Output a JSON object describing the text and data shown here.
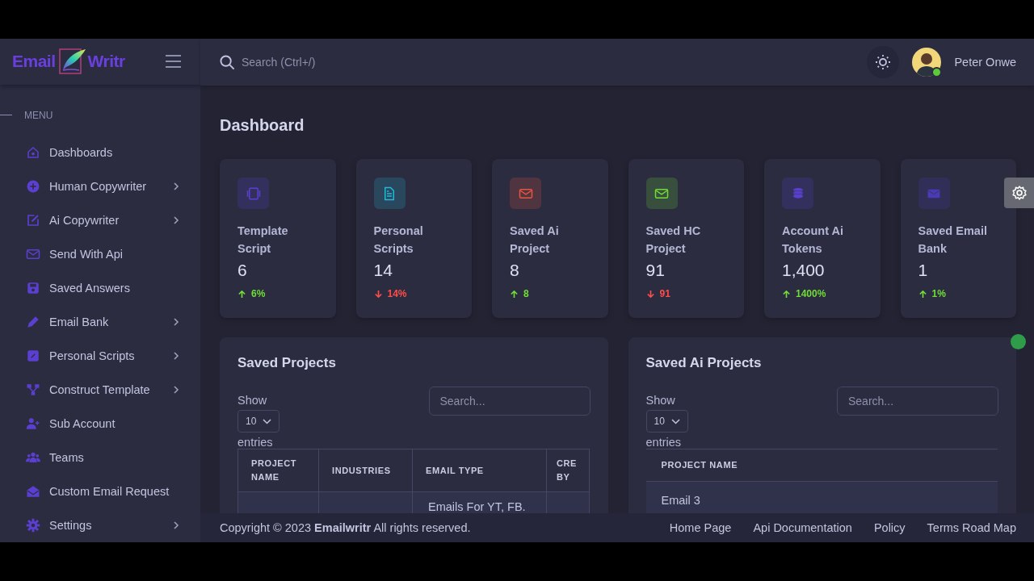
{
  "logo": {
    "text_left": "Email",
    "text_right": "Writr"
  },
  "sidebar": {
    "section_label": "MENU",
    "items": [
      {
        "label": "Dashboards",
        "kind": "home",
        "submenu": false
      },
      {
        "label": "Human Copywriter",
        "kind": "plus",
        "submenu": true
      },
      {
        "label": "Ai Copywriter",
        "kind": "edit",
        "submenu": true
      },
      {
        "label": "Send With Api",
        "kind": "mail",
        "submenu": false
      },
      {
        "label": "Saved Answers",
        "kind": "save",
        "submenu": false
      },
      {
        "label": "Email Bank",
        "kind": "pencil",
        "submenu": true
      },
      {
        "label": "Personal Scripts",
        "kind": "note",
        "submenu": true
      },
      {
        "label": "Construct Template",
        "kind": "network",
        "submenu": true
      },
      {
        "label": "Sub Account",
        "kind": "useradd",
        "submenu": false
      },
      {
        "label": "Teams",
        "kind": "group",
        "submenu": false
      },
      {
        "label": "Custom Email Request",
        "kind": "mailopen",
        "submenu": false
      },
      {
        "label": "Settings",
        "kind": "gear",
        "submenu": true
      }
    ]
  },
  "topbar": {
    "search": {
      "placeholder": "Search (Ctrl+/)"
    },
    "user": {
      "name": "Peter Onwe",
      "online": true
    }
  },
  "page_title": "Dashboard",
  "stats": [
    {
      "label": "Template Script",
      "value": "6",
      "change": "6%",
      "rising": true,
      "kind": "layout",
      "color": "#5b3fd0"
    },
    {
      "label": "Personal Scripts",
      "value": "14",
      "change": "14%",
      "rising": false,
      "kind": "document",
      "color": "#22b8d8"
    },
    {
      "label": "Saved Ai Project",
      "value": "8",
      "change": "8",
      "rising": true,
      "kind": "mail",
      "color": "#e8553e"
    },
    {
      "label": "Saved HC Project",
      "value": "91",
      "change": "91",
      "rising": false,
      "kind": "mail",
      "color": "#71dd37"
    },
    {
      "label": "Account Ai Tokens",
      "value": "1,400",
      "change": "1400%",
      "rising": true,
      "kind": "coins",
      "color": "#5b3fd0"
    },
    {
      "label": "Saved Email Bank",
      "value": "1",
      "change": "1%",
      "rising": true,
      "kind": "mailfill",
      "color": "#4a3ab8"
    }
  ],
  "panels": [
    {
      "title": "Saved Projects",
      "show_label": "Show",
      "page_size": "10",
      "entries_label": "entries",
      "search": {
        "placeholder": "Search..."
      },
      "columns": [
        "PROJECT NAME",
        "INDUSTRIES",
        "EMAIL TYPE",
        "CRE BY"
      ],
      "rows": [
        {
          "cells": [
            null,
            null,
            "Emails For YT, FB.",
            null
          ]
        }
      ]
    },
    {
      "title": "Saved Ai Projects",
      "show_label": "Show",
      "page_size": "10",
      "entries_label": "entries",
      "search": {
        "placeholder": "Search..."
      },
      "columns": [
        "PROJECT NAME"
      ],
      "rows": [
        {
          "cells": [
            "Email 3"
          ]
        }
      ]
    }
  ],
  "footer": {
    "copyright": "Copyright © 2023 **Emailwritr** All rights reserved.",
    "links": [
      "Home Page",
      "Api Documentation",
      "Policy",
      "Terms Road Map"
    ]
  }
}
